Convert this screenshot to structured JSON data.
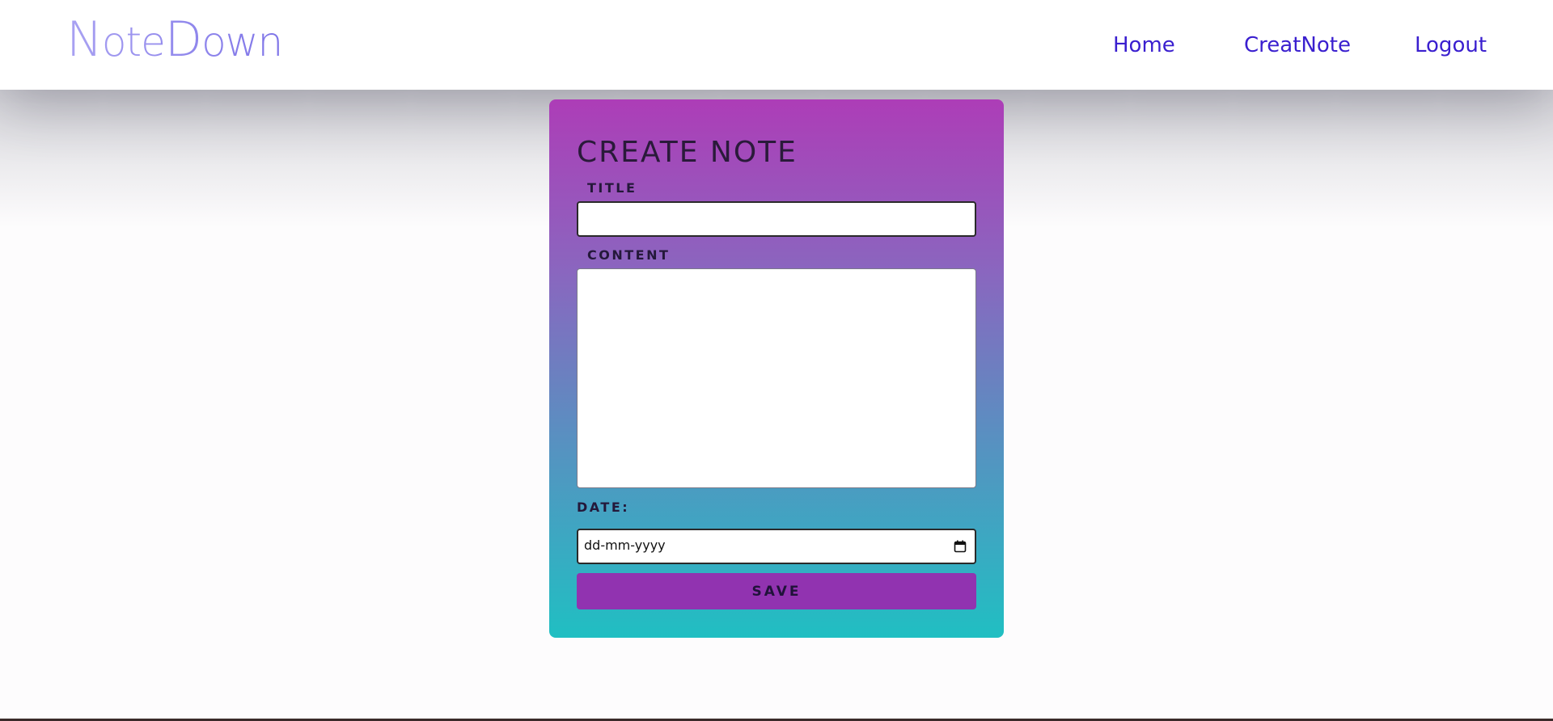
{
  "navbar": {
    "brand": {
      "first_cap": "N",
      "first_rest": "ote",
      "second_cap": "D",
      "second_rest": "own"
    },
    "links": {
      "home": "Home",
      "create": "CreatNote",
      "logout": "Logout"
    },
    "link_color": "#3a1fcf",
    "brand_color": "#8e86ec"
  },
  "form": {
    "heading": "CREATE NOTE",
    "title_label": "TITLE",
    "title_value": "",
    "content_label": "CONTENT",
    "content_value": "",
    "date_label": "DATE:",
    "date_placeholder": "dd-mm-yyyy",
    "save_label": "SAVE",
    "gradient_top": "#ad3db7",
    "gradient_bottom": "#20bfc2",
    "save_color": "#9133b0"
  },
  "icons": {
    "date_picker": "calendar-icon"
  }
}
